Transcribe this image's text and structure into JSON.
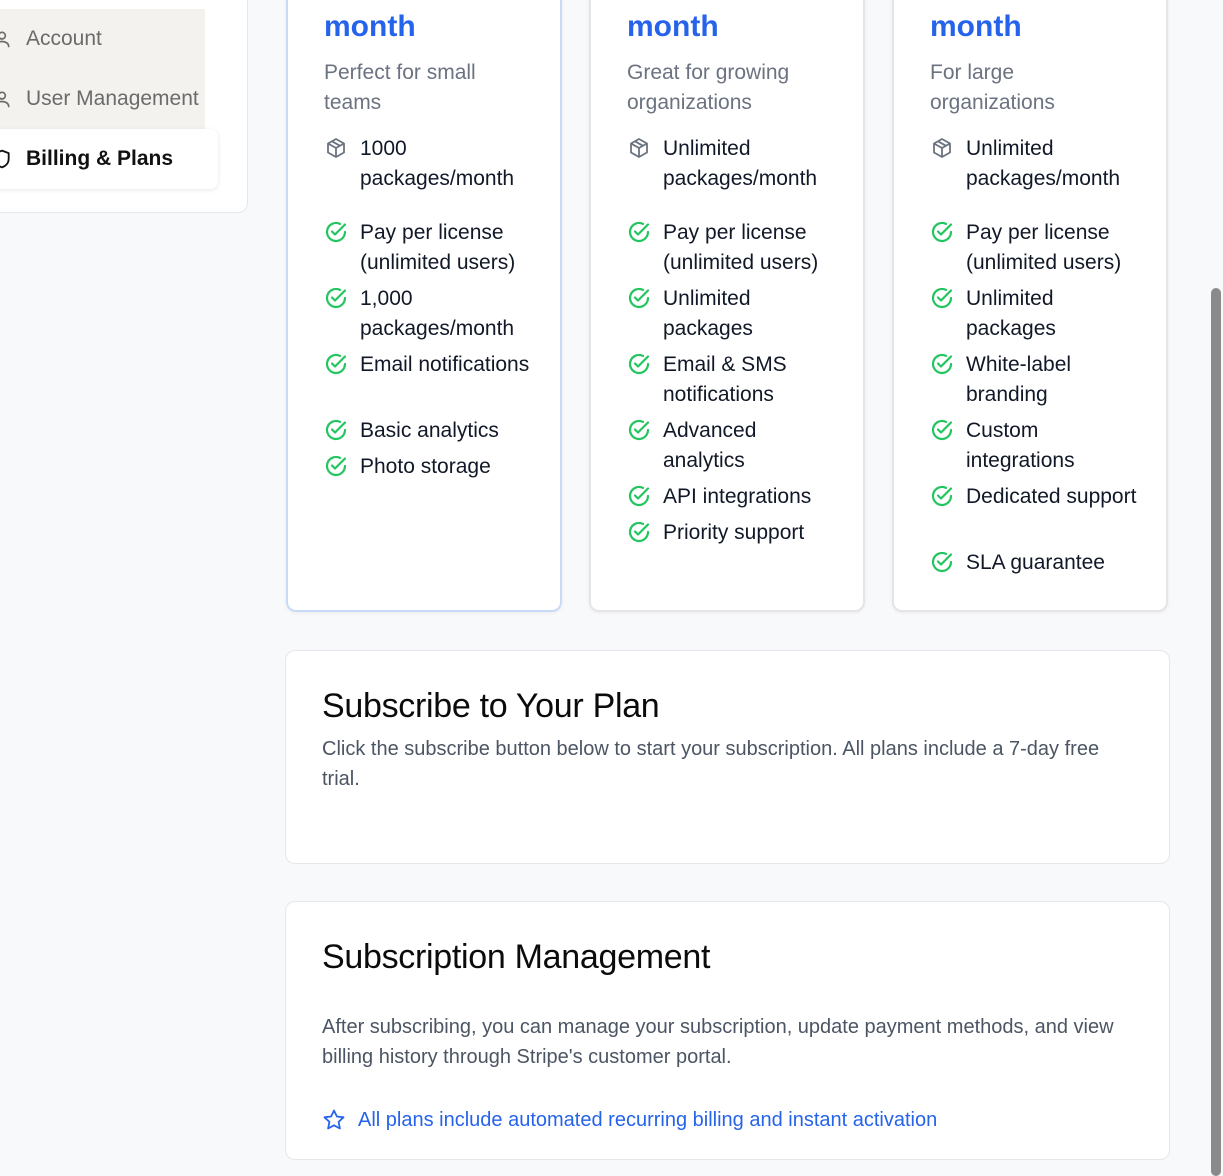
{
  "sidebar": {
    "items": [
      {
        "label": "Account",
        "icon": "user-icon"
      },
      {
        "label": "User Management",
        "icon": "user-icon"
      },
      {
        "label": "Billing & Plans",
        "icon": "shield-icon",
        "active": true
      }
    ]
  },
  "plans": [
    {
      "period": "month",
      "description": "Perfect for small teams",
      "packages": "1000 packages/month",
      "features": [
        "Pay per license (unlimited users)",
        "1,000 packages/month",
        "Email notifications",
        "Basic analytics",
        "Photo storage"
      ]
    },
    {
      "period": "month",
      "description": "Great for growing organizations",
      "packages": "Unlimited packages/month",
      "features": [
        "Pay per license (unlimited users)",
        "Unlimited packages",
        "Email & SMS notifications",
        "Advanced analytics",
        "API integrations",
        "Priority support"
      ]
    },
    {
      "period": "month",
      "description": "For large organizations",
      "packages": "Unlimited packages/month",
      "features": [
        "Pay per license (unlimited users)",
        "Unlimited packages",
        "White-label branding",
        "Custom integrations",
        "Dedicated support",
        "SLA guarantee"
      ]
    }
  ],
  "subscribe": {
    "title": "Subscribe to Your Plan",
    "text": "Click the subscribe button below to start your subscription. All plans include a 7-day free trial."
  },
  "management": {
    "title": "Subscription Management",
    "text": "After subscribing, you can manage your subscription, update payment methods, and view billing history through Stripe's customer portal.",
    "note": "All plans include automated recurring billing and instant activation"
  },
  "colors": {
    "accent": "#2563eb",
    "check": "#22c55e"
  }
}
